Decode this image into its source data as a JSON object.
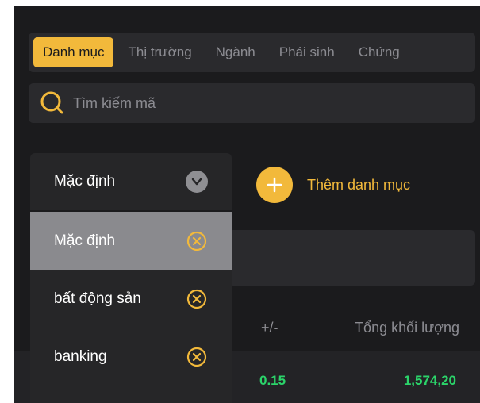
{
  "tabs": [
    {
      "label": "Danh mục",
      "active": true
    },
    {
      "label": "Thị trường",
      "active": false
    },
    {
      "label": "Ngành",
      "active": false
    },
    {
      "label": "Phái sinh",
      "active": false
    },
    {
      "label": "Chứng",
      "active": false
    }
  ],
  "search": {
    "placeholder": "Tìm kiếm mã"
  },
  "watchlist_select": {
    "current": "Mặc định"
  },
  "watchlist_menu": [
    {
      "label": "Mặc định",
      "selected": true
    },
    {
      "label": "bất động sản",
      "selected": false
    },
    {
      "label": "banking",
      "selected": false
    }
  ],
  "add_watchlist": {
    "label": "Thêm danh mục"
  },
  "table": {
    "columns": [
      "+/-",
      "Tổng khối lượng"
    ],
    "rows": [
      {
        "change": "0.15",
        "total_volume": "1,574,20"
      }
    ]
  },
  "colors": {
    "accent": "#f2b93b",
    "positive": "#2bd46a",
    "background": "#1b1b1d"
  }
}
